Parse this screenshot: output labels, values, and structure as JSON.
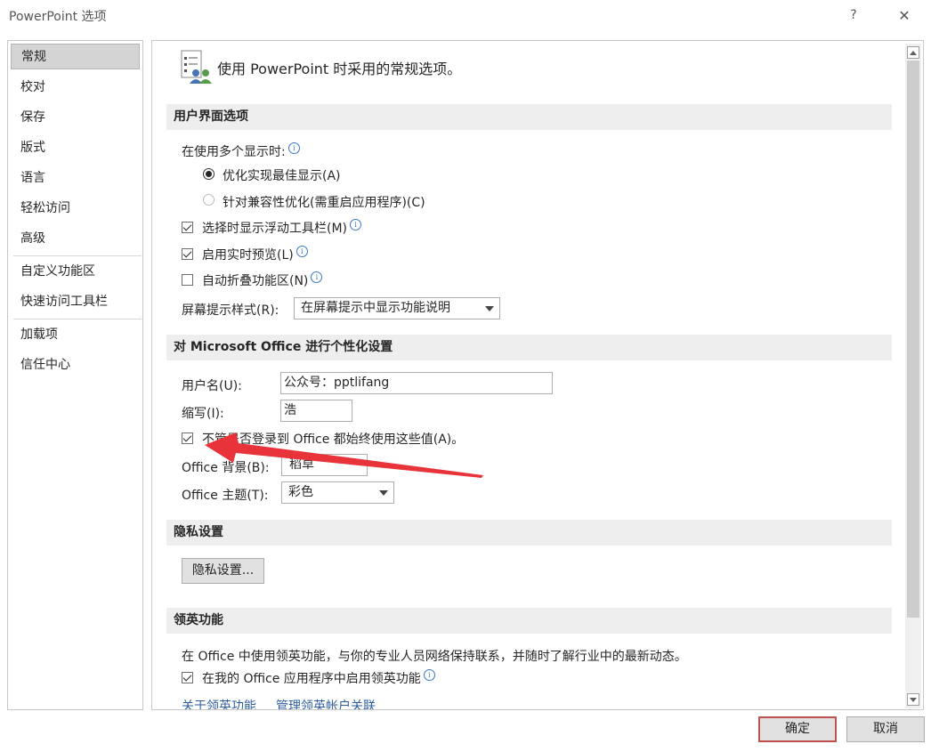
{
  "window": {
    "title": "PowerPoint 选项",
    "help": "?",
    "close": "✕"
  },
  "nav": {
    "items": [
      "常规",
      "校对",
      "保存",
      "版式",
      "语言",
      "轻松访问",
      "高级",
      "自定义功能区",
      "快速访问工具栏",
      "加载项",
      "信任中心"
    ],
    "selected": "常规"
  },
  "header": {
    "text": "使用 PowerPoint 时采用的常规选项。"
  },
  "ui_section": {
    "title": "用户界面选项",
    "multi_display_label": "在使用多个显示时:",
    "radio_best": "优化实现最佳显示(A)",
    "radio_compat": "针对兼容性优化(需重启应用程序)(C)",
    "mini_toolbar": "选择时显示浮动工具栏(M)",
    "live_preview": "启用实时预览(L)",
    "collapse_ribbon": "自动折叠功能区(N)",
    "screentip_label": "屏幕提示样式(R):",
    "screentip_value": "在屏幕提示中显示功能说明"
  },
  "personal_section": {
    "title": "对 Microsoft Office 进行个性化设置",
    "username_label": "用户名(U):",
    "username_value": "公众号：pptlifang",
    "initials_label": "缩写(I):",
    "initials_value": "浩",
    "always_use": "不管是否登录到 Office 都始终使用这些值(A)。",
    "background_label": "Office 背景(B):",
    "background_value": "稻草",
    "theme_label": "Office 主题(T):",
    "theme_value": "彩色"
  },
  "privacy_section": {
    "title": "隐私设置",
    "button": "隐私设置..."
  },
  "linkedin_section": {
    "title": "领英功能",
    "description": "在 Office 中使用领英功能，与你的专业人员网络保持联系，并随时了解行业中的最新动态。",
    "enable": "在我的 Office 应用程序中启用领英功能",
    "about_link": "关于领英功能",
    "manage_link": "管理领英帐户关联"
  },
  "footer": {
    "ok": "确定",
    "cancel": "取消"
  },
  "colors": {
    "annotation_arrow": "#e8333a",
    "link": "#2e5e9e",
    "ok_border": "#c0504d"
  }
}
